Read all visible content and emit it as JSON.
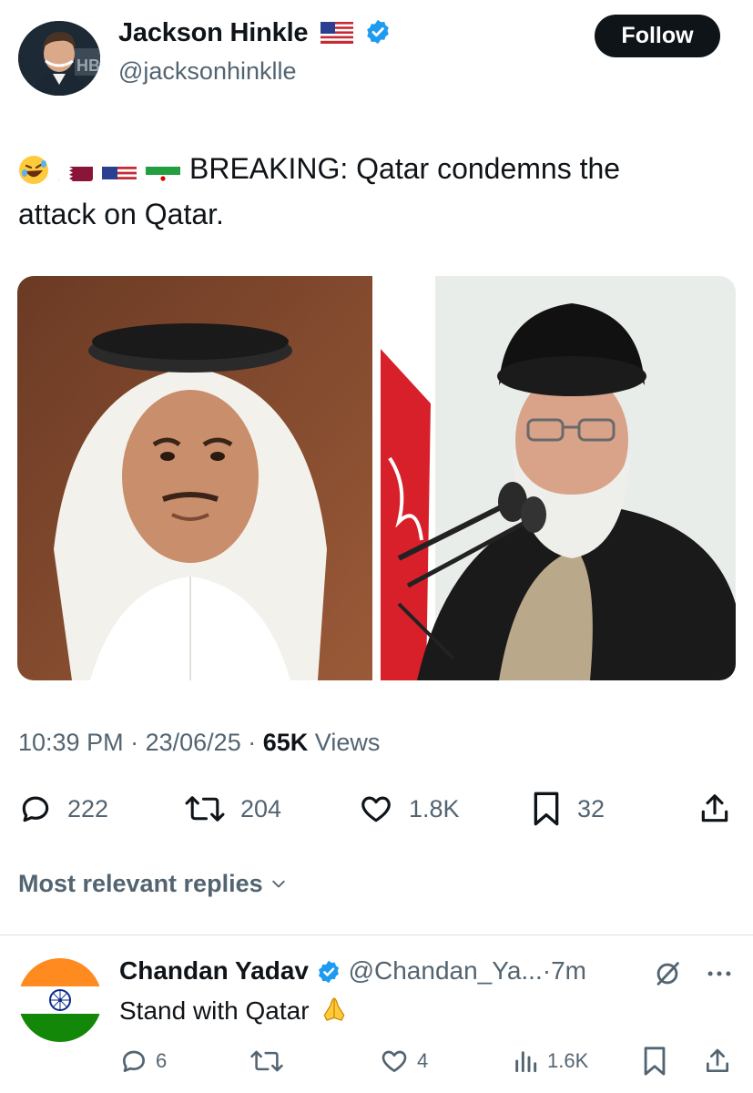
{
  "author": {
    "name": "Jackson Hinkle",
    "handle": "@jacksonhinklle",
    "follow_label": "Follow"
  },
  "tweet": {
    "text_line1": "BREAKING: Qatar condemns the",
    "text_line2": "attack on Qatar.",
    "emojis": [
      "rolling-laughing-emoji",
      "qatar-flag",
      "us-flag",
      "iran-flag"
    ]
  },
  "meta": {
    "time": "10:39 PM",
    "sep1": "·",
    "date": "23/06/25",
    "sep2": "·",
    "views_count": "65K",
    "views_label": "Views"
  },
  "actions": {
    "replies": "222",
    "reposts": "204",
    "likes": "1.8K",
    "bookmarks": "32"
  },
  "replies_sort": {
    "label": "Most relevant replies"
  },
  "reply": {
    "name": "Chandan Yadav",
    "handle": "@Chandan_Ya...",
    "sep": "·",
    "time": "7m",
    "text": "Stand with Qatar",
    "replies": "6",
    "reposts": "",
    "likes": "4",
    "views": "1.6K"
  },
  "colors": {
    "text": "#0f1419",
    "muted": "#536471",
    "verified": "#1d9bf0",
    "follow_bg": "#0f1419"
  }
}
